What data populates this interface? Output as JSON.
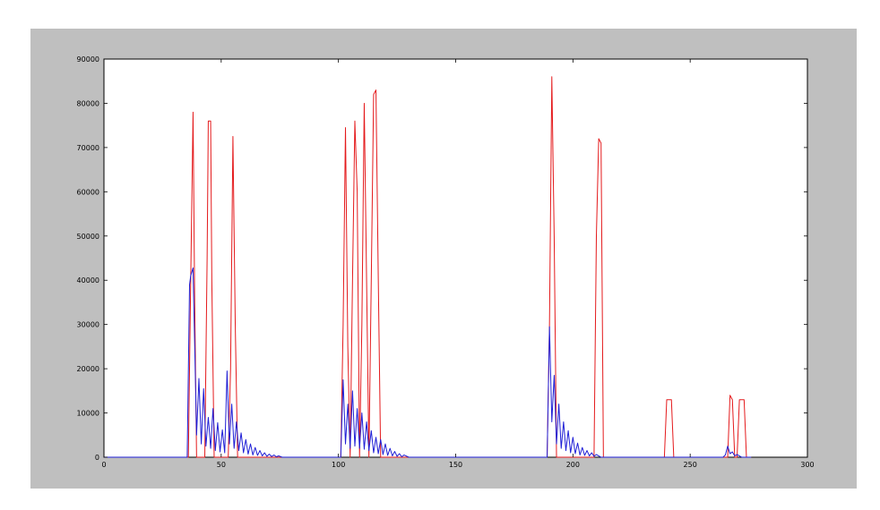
{
  "chart_data": {
    "type": "line",
    "xlim": [
      0,
      300
    ],
    "ylim": [
      0,
      90000
    ],
    "xticks": [
      0,
      50,
      100,
      150,
      200,
      250,
      300
    ],
    "yticks": [
      0,
      10000,
      20000,
      30000,
      40000,
      50000,
      60000,
      70000,
      80000,
      90000
    ],
    "grid": false,
    "colors": {
      "red": "#e41a1c",
      "blue": "#1f1fd6",
      "frame": "#bfbfbf",
      "plot_bg": "#ffffff"
    },
    "series": [
      {
        "color": "#e41a1c",
        "points": [
          [
            0,
            0
          ],
          [
            36,
            0
          ],
          [
            37,
            40000
          ],
          [
            38,
            78000
          ],
          [
            38.7,
            35000
          ],
          [
            39.5,
            0
          ],
          [
            43,
            0
          ],
          [
            44,
            45000
          ],
          [
            44.5,
            76000
          ],
          [
            45.5,
            76000
          ],
          [
            46,
            40000
          ],
          [
            47,
            0
          ],
          [
            53,
            0
          ],
          [
            54,
            20000
          ],
          [
            55,
            72500
          ],
          [
            56,
            30000
          ],
          [
            57,
            0
          ],
          [
            101,
            0
          ],
          [
            102,
            30000
          ],
          [
            103,
            74500
          ],
          [
            104,
            25000
          ],
          [
            105,
            0
          ],
          [
            106,
            40000
          ],
          [
            107,
            76000
          ],
          [
            108,
            60000
          ],
          [
            109,
            0
          ],
          [
            110,
            30000
          ],
          [
            111,
            80000
          ],
          [
            112,
            40000
          ],
          [
            113,
            0
          ],
          [
            114,
            40000
          ],
          [
            115,
            82000
          ],
          [
            116,
            83000
          ],
          [
            117,
            40000
          ],
          [
            118,
            0
          ],
          [
            189,
            0
          ],
          [
            190,
            30000
          ],
          [
            191,
            86000
          ],
          [
            192,
            50000
          ],
          [
            193,
            0
          ],
          [
            209,
            0
          ],
          [
            210,
            50000
          ],
          [
            211,
            72000
          ],
          [
            212,
            71000
          ],
          [
            213,
            0
          ],
          [
            239,
            0
          ],
          [
            240,
            13000
          ],
          [
            242,
            13000
          ],
          [
            243,
            0
          ],
          [
            266,
            0
          ],
          [
            267,
            14000
          ],
          [
            268,
            13000
          ],
          [
            269,
            0
          ],
          [
            270,
            0
          ],
          [
            271,
            13000
          ],
          [
            273,
            13000
          ],
          [
            274,
            0
          ],
          [
            276,
            0
          ]
        ]
      },
      {
        "color": "#1f1fd6",
        "points": [
          [
            0,
            0
          ],
          [
            35.5,
            0
          ],
          [
            36.5,
            39000
          ],
          [
            37,
            41000
          ],
          [
            38,
            42800
          ],
          [
            39.5,
            5000
          ],
          [
            40.5,
            17800
          ],
          [
            41.5,
            3000
          ],
          [
            42.5,
            15500
          ],
          [
            43.5,
            2500
          ],
          [
            44.5,
            9000
          ],
          [
            45.5,
            2000
          ],
          [
            46.5,
            11000
          ],
          [
            47.5,
            1500
          ],
          [
            48.5,
            7800
          ],
          [
            49.5,
            1200
          ],
          [
            50.5,
            6200
          ],
          [
            51.5,
            1000
          ],
          [
            52.5,
            19500
          ],
          [
            53.5,
            3000
          ],
          [
            54.5,
            12000
          ],
          [
            55.5,
            2000
          ],
          [
            56.5,
            8000
          ],
          [
            57.5,
            1500
          ],
          [
            58.5,
            5500
          ],
          [
            59.5,
            1000
          ],
          [
            60.5,
            4000
          ],
          [
            61.5,
            700
          ],
          [
            62.5,
            3000
          ],
          [
            63.5,
            500
          ],
          [
            64.5,
            2200
          ],
          [
            65.5,
            400
          ],
          [
            66.5,
            1500
          ],
          [
            67.5,
            300
          ],
          [
            68.5,
            1000
          ],
          [
            69.5,
            200
          ],
          [
            70.5,
            700
          ],
          [
            71.5,
            150
          ],
          [
            72.5,
            500
          ],
          [
            73.5,
            100
          ],
          [
            74.5,
            300
          ],
          [
            76,
            0
          ],
          [
            101,
            0
          ],
          [
            102,
            17500
          ],
          [
            103,
            3000
          ],
          [
            104,
            12000
          ],
          [
            105,
            2000
          ],
          [
            106,
            15000
          ],
          [
            107,
            2500
          ],
          [
            108,
            11000
          ],
          [
            109,
            2000
          ],
          [
            110,
            10000
          ],
          [
            111,
            1800
          ],
          [
            112,
            8000
          ],
          [
            113,
            1500
          ],
          [
            114,
            6000
          ],
          [
            115,
            1000
          ],
          [
            116,
            4500
          ],
          [
            117,
            800
          ],
          [
            118,
            4000
          ],
          [
            119,
            600
          ],
          [
            120,
            3000
          ],
          [
            121,
            400
          ],
          [
            122,
            2000
          ],
          [
            123,
            300
          ],
          [
            124,
            1300
          ],
          [
            125,
            200
          ],
          [
            126,
            800
          ],
          [
            127,
            100
          ],
          [
            128,
            500
          ],
          [
            130,
            0
          ],
          [
            189,
            0
          ],
          [
            190,
            29500
          ],
          [
            191,
            8000
          ],
          [
            192,
            18500
          ],
          [
            193,
            3000
          ],
          [
            194,
            12000
          ],
          [
            195,
            2000
          ],
          [
            196,
            8000
          ],
          [
            197,
            1500
          ],
          [
            198,
            6000
          ],
          [
            199,
            1000
          ],
          [
            200,
            4500
          ],
          [
            201,
            800
          ],
          [
            202,
            3200
          ],
          [
            203,
            500
          ],
          [
            204,
            2200
          ],
          [
            205,
            400
          ],
          [
            206,
            1500
          ],
          [
            207,
            300
          ],
          [
            208,
            1000
          ],
          [
            209,
            200
          ],
          [
            210,
            600
          ],
          [
            212,
            0
          ],
          [
            264,
            0
          ],
          [
            265,
            500
          ],
          [
            266,
            2500
          ],
          [
            267,
            800
          ],
          [
            268,
            1200
          ],
          [
            269,
            300
          ],
          [
            270,
            600
          ],
          [
            272,
            0
          ],
          [
            276,
            0
          ]
        ]
      }
    ]
  }
}
